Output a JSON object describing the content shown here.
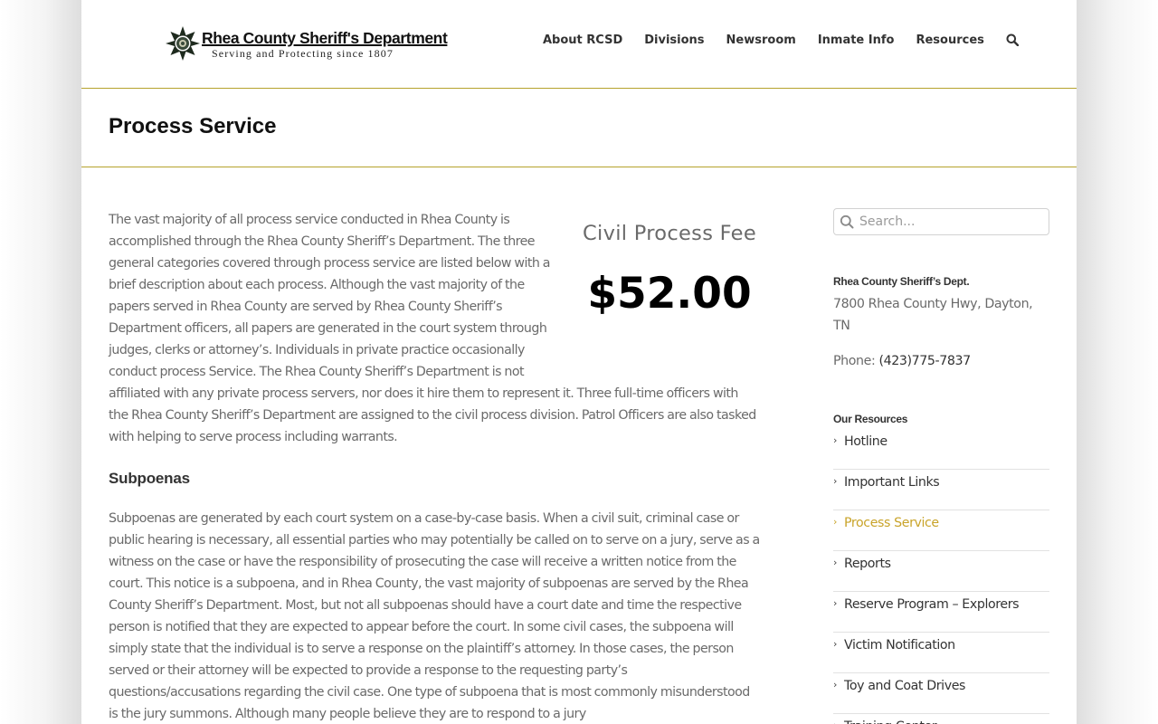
{
  "site": {
    "title": "Rhea County Sheriff's Department",
    "tagline": "Serving and Protecting since 1807"
  },
  "nav": {
    "items": [
      {
        "label": "About RCSD"
      },
      {
        "label": "Divisions"
      },
      {
        "label": "Newsroom"
      },
      {
        "label": "Inmate Info"
      },
      {
        "label": "Resources"
      }
    ],
    "search_icon": "search-icon"
  },
  "page": {
    "title": "Process Service"
  },
  "fee": {
    "label": "Civil Process Fee",
    "amount": "$52.00"
  },
  "content": {
    "intro": "The vast majority of all process service conducted in Rhea County is accomplished through the Rhea County Sheriff’s Department. The three general categories covered through process service are listed below with a brief description about each process. Although the vast majority of the papers served in Rhea County are served by Rhea County Sheriff’s Department officers, all papers are generated in the court system through judges, clerks or attorney’s. Individuals in private practice occasionally conduct process Service. The Rhea County Sheriff’s Department is not affiliated with any private process servers, nor does it hire them to represent it. Three full-time officers with the Rhea County Sheriff’s Department are assigned to the civil process division. Patrol Officers are also tasked with helping to serve process including warrants.",
    "subpoenas_heading": "Subpoenas",
    "subpoenas_text": "Subpoenas are generated by each court system on a case-by-case basis. When a civil suit, criminal case or public hearing is necessary, all essential parties who may potentially be called on to serve on a jury, serve as a witness on the case or have the responsibility of prosecuting the case will receive a written notice from the court. This notice is a subpoena, and in Rhea County, the vast majority of subpoenas are served by the Rhea County Sheriff’s Department. Most, but not all subpoenas should have a court date and time the respective person is notified that they are expected to appear before the court. In some civil cases, the subpoena will simply state that the individual is to serve a response on the plaintiff’s attorney. In those cases, the person served or their attorney will be expected to provide a response to the requesting party’s questions/accusations regarding the civil case. One type of subpoena that is most commonly misunderstood is the jury summons. Although many people believe they are to respond to a jury"
  },
  "sidebar": {
    "search_placeholder": "Search...",
    "dept_heading": "Rhea County Sheriff’s Dept.",
    "address": "7800 Rhea County Hwy, Dayton, TN",
    "phone_label": "Phone: ",
    "phone_number": "(423)775-7837",
    "resources_heading": "Our Resources",
    "resources": [
      {
        "label": "Hotline",
        "active": false
      },
      {
        "label": "Important Links",
        "active": false
      },
      {
        "label": "Process Service",
        "active": true
      },
      {
        "label": "Reports",
        "active": false
      },
      {
        "label": "Reserve Program – Explorers",
        "active": false
      },
      {
        "label": "Victim Notification",
        "active": false
      },
      {
        "label": "Toy and Coat Drives",
        "active": false
      },
      {
        "label": "Training Center",
        "active": false
      }
    ]
  },
  "colors": {
    "accent": "#c9a42a",
    "rule": "#b5a22c",
    "text": "#6a6a6a",
    "heading": "#333333"
  }
}
